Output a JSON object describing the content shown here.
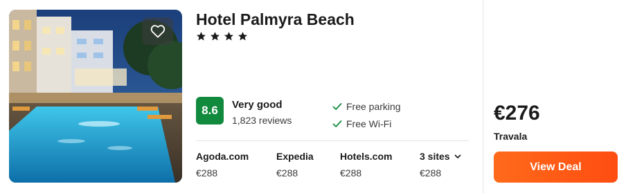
{
  "hotel": {
    "name": "Hotel Palmyra Beach",
    "star_count": 4,
    "rating_score": "8.6",
    "rating_label": "Very good",
    "reviews": "1,823 reviews"
  },
  "amenities": [
    "Free parking",
    "Free Wi-Fi"
  ],
  "sites": [
    {
      "name": "Agoda.com",
      "price": "€288"
    },
    {
      "name": "Expedia",
      "price": "€288"
    },
    {
      "name": "Hotels.com",
      "price": "€288"
    },
    {
      "name": "3 sites",
      "price": "€288"
    }
  ],
  "deal": {
    "price": "€276",
    "provider": "Travala",
    "button_label": "View Deal"
  },
  "colors": {
    "rating_badge": "#128a3e",
    "deal_button": "#ff5a14",
    "check": "#128a3e"
  },
  "icons": {
    "favorite": "heart-icon",
    "star": "star-icon",
    "amenity": "check-icon",
    "more_sites": "chevron-down-icon"
  }
}
